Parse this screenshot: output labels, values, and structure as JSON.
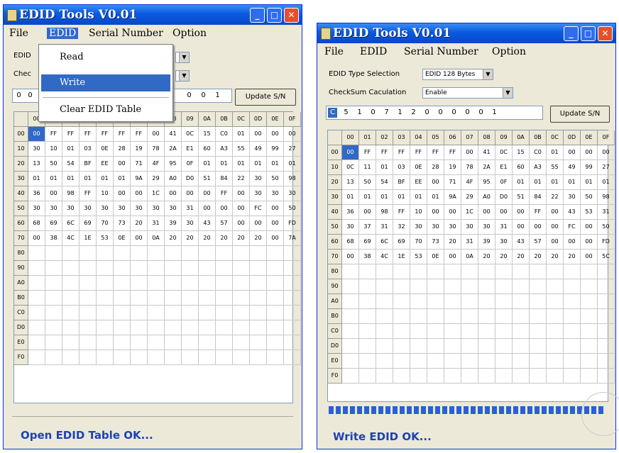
{
  "windows": [
    {
      "id": "left",
      "title": "EDID Tools V0.01",
      "menus": [
        "File",
        "EDID",
        "Serial Number",
        "Option"
      ],
      "open_menu": "EDID",
      "dropdown_items": [
        "Read",
        "Write",
        "Clear EDID Table"
      ],
      "highlighted_item": "Write",
      "labels": [
        "EDID",
        "Chec"
      ],
      "serial_digits": [
        "0",
        "0",
        "0",
        "0",
        "1"
      ],
      "update_button": "Update S/N",
      "col_headers": [
        "00",
        "01",
        "02",
        "03",
        "04",
        "05",
        "06",
        "07",
        "08",
        "09",
        "0A",
        "0B",
        "0C",
        "0D",
        "0E",
        "0F"
      ],
      "row_headers": [
        "00",
        "10",
        "20",
        "30",
        "40",
        "50",
        "60",
        "70",
        "80",
        "90",
        "A0",
        "B0",
        "C0",
        "D0",
        "E0",
        "F0"
      ],
      "rows": [
        [
          "00",
          "FF",
          "FF",
          "FF",
          "FF",
          "FF",
          "FF",
          "00",
          "41",
          "0C",
          "15",
          "C0",
          "01",
          "00",
          "00",
          "00"
        ],
        [
          "30",
          "10",
          "01",
          "03",
          "0E",
          "28",
          "19",
          "78",
          "2A",
          "E1",
          "60",
          "A3",
          "55",
          "49",
          "99",
          "27"
        ],
        [
          "13",
          "50",
          "54",
          "BF",
          "EE",
          "00",
          "71",
          "4F",
          "95",
          "0F",
          "01",
          "01",
          "01",
          "01",
          "01",
          "01"
        ],
        [
          "01",
          "01",
          "01",
          "01",
          "01",
          "01",
          "9A",
          "29",
          "A0",
          "D0",
          "51",
          "84",
          "22",
          "30",
          "50",
          "98"
        ],
        [
          "36",
          "00",
          "98",
          "FF",
          "10",
          "00",
          "00",
          "1C",
          "00",
          "00",
          "00",
          "FF",
          "00",
          "30",
          "30",
          "30"
        ],
        [
          "30",
          "30",
          "30",
          "30",
          "30",
          "30",
          "30",
          "30",
          "30",
          "31",
          "00",
          "00",
          "00",
          "FC",
          "00",
          "50"
        ],
        [
          "68",
          "69",
          "6C",
          "69",
          "70",
          "73",
          "20",
          "31",
          "39",
          "30",
          "43",
          "57",
          "00",
          "00",
          "00",
          "FD"
        ],
        [
          "00",
          "38",
          "4C",
          "1E",
          "53",
          "0E",
          "00",
          "0A",
          "20",
          "20",
          "20",
          "20",
          "20",
          "20",
          "00",
          "7A"
        ]
      ],
      "status": "Open EDID Table OK..."
    },
    {
      "id": "right",
      "title": "EDID Tools V0.01",
      "menus": [
        "File",
        "EDID",
        "Serial Number",
        "Option"
      ],
      "labels": [
        "EDID Type Selection",
        "CheckSum Caculation"
      ],
      "combos": [
        "EDID 128 Bytes",
        "Enable"
      ],
      "serial_digits": [
        "C",
        "5",
        "1",
        "0",
        "7",
        "1",
        "2",
        "0",
        "0",
        "0",
        "0",
        "0",
        "1"
      ],
      "update_button": "Update S/N",
      "col_headers": [
        "00",
        "01",
        "02",
        "03",
        "04",
        "05",
        "06",
        "07",
        "08",
        "09",
        "0A",
        "0B",
        "0C",
        "0D",
        "0E",
        "0F"
      ],
      "row_headers": [
        "00",
        "10",
        "20",
        "30",
        "40",
        "50",
        "60",
        "70",
        "80",
        "90",
        "A0",
        "B0",
        "C0",
        "D0",
        "E0",
        "F0"
      ],
      "rows": [
        [
          "00",
          "FF",
          "FF",
          "FF",
          "FF",
          "FF",
          "FF",
          "00",
          "41",
          "0C",
          "15",
          "C0",
          "01",
          "00",
          "00",
          "00"
        ],
        [
          "0C",
          "11",
          "01",
          "03",
          "0E",
          "28",
          "19",
          "78",
          "2A",
          "E1",
          "60",
          "A3",
          "55",
          "49",
          "99",
          "27"
        ],
        [
          "13",
          "50",
          "54",
          "BF",
          "EE",
          "00",
          "71",
          "4F",
          "95",
          "0F",
          "01",
          "01",
          "01",
          "01",
          "01",
          "01"
        ],
        [
          "01",
          "01",
          "01",
          "01",
          "01",
          "01",
          "9A",
          "29",
          "A0",
          "D0",
          "51",
          "84",
          "22",
          "30",
          "50",
          "98"
        ],
        [
          "36",
          "00",
          "98",
          "FF",
          "10",
          "00",
          "00",
          "1C",
          "00",
          "00",
          "00",
          "FF",
          "00",
          "43",
          "53",
          "31"
        ],
        [
          "30",
          "37",
          "31",
          "32",
          "30",
          "30",
          "30",
          "30",
          "30",
          "31",
          "00",
          "00",
          "00",
          "FC",
          "00",
          "50"
        ],
        [
          "68",
          "69",
          "6C",
          "69",
          "70",
          "73",
          "20",
          "31",
          "39",
          "30",
          "43",
          "57",
          "00",
          "00",
          "00",
          "FD"
        ],
        [
          "00",
          "38",
          "4C",
          "1E",
          "53",
          "0E",
          "00",
          "0A",
          "20",
          "20",
          "20",
          "20",
          "20",
          "20",
          "00",
          "5C"
        ]
      ],
      "progress": 1.0,
      "status": "Write EDID OK..."
    }
  ],
  "icons": {
    "app": "app-icon",
    "minimize": "minimize-icon",
    "maximize": "maximize-icon",
    "close": "close-icon"
  },
  "colors": {
    "titlebar": "#0a5ae0",
    "selection": "#316ac5",
    "status_text": "#1c43b4",
    "progress": "#2b5fd9"
  }
}
